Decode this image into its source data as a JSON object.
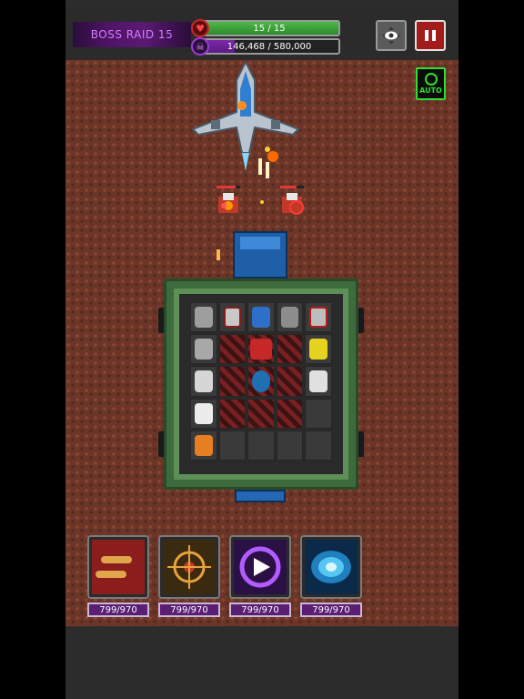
{
  "hud": {
    "title": "BOSS RAID 15",
    "hp_text": "15 / 15",
    "hp_fraction": 1.0,
    "boss_text": "146,468 / 580,000",
    "boss_fraction": 0.2525,
    "heart_icon": "heart-icon",
    "boss_icon": "skull-icon",
    "view_icon": "eye-icon",
    "pause_icon": "pause-icon"
  },
  "auto_button": {
    "label": "AUTO"
  },
  "skills": [
    {
      "name": "bullets-skill",
      "count": "799/970"
    },
    {
      "name": "target-skill",
      "count": "799/970"
    },
    {
      "name": "dash-skill",
      "count": "799/970"
    },
    {
      "name": "vortex-skill",
      "count": "799/970"
    }
  ],
  "colors": {
    "ground": "#6b3628",
    "hp_fill": "#4fb84a",
    "boss_fill": "#7a2aa8",
    "auto_green": "#2ee02e",
    "pause_red": "#a31b1b"
  }
}
